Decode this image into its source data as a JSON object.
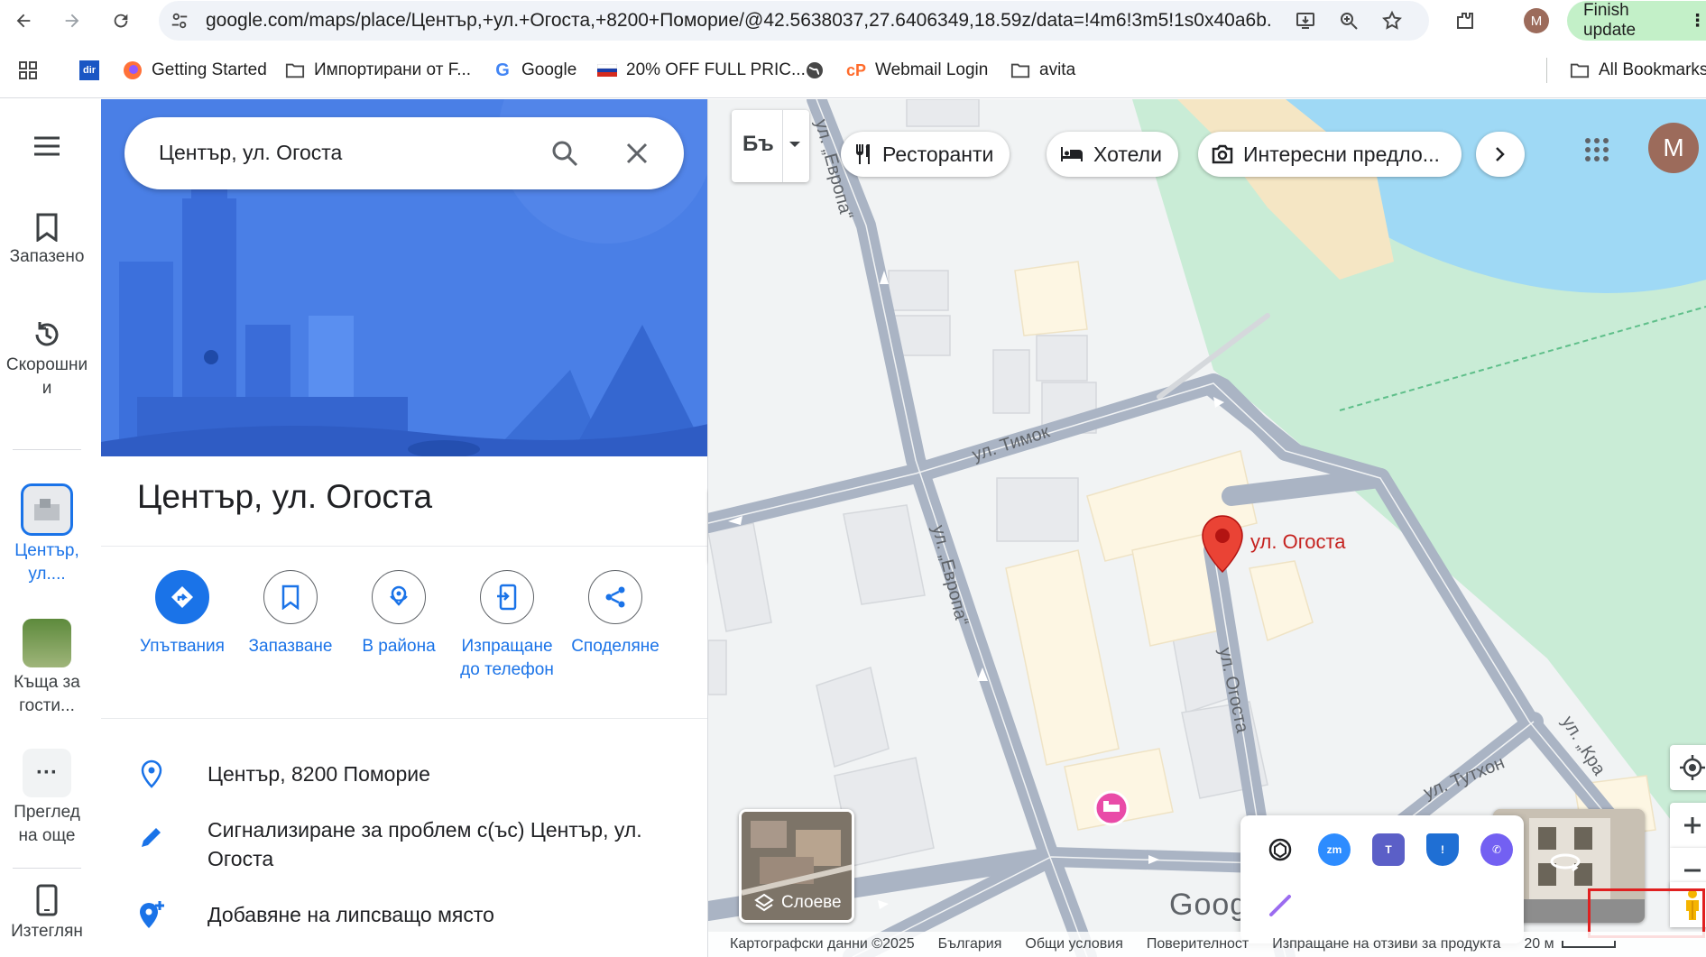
{
  "browser": {
    "url": "google.com/maps/place/Център,+ул.+Огоста,+8200+Поморие/@42.5638037,27.6406349,18.59z/data=!4m6!3m5!1s0x40a6b...",
    "profile_initial": "M",
    "finish_update_label": "Finish update",
    "bookmarks": [
      {
        "label": "",
        "icon": "apps-grid-icon"
      },
      {
        "label": "dir",
        "icon": "dir-badge-icon"
      },
      {
        "label": "Getting Started",
        "icon": "firefox-icon"
      },
      {
        "label": "Импортирани от F...",
        "icon": "folder-icon"
      },
      {
        "label": "Google",
        "icon": "google-g-icon"
      },
      {
        "label": "20% OFF FULL PRIC...",
        "icon": "flag-icon"
      },
      {
        "label": "",
        "icon": "globe-icon"
      },
      {
        "label": "Webmail Login",
        "icon": "cpanel-icon"
      },
      {
        "label": "avita",
        "icon": "folder-icon"
      },
      {
        "label": "All Bookmarks",
        "icon": "folder-icon"
      }
    ]
  },
  "rail": {
    "saved": "Запазено",
    "recents": "Скорошни",
    "recents_tail": "и",
    "current_place": "Център,",
    "current_place_tail": "ул....",
    "house": "Къща за",
    "house_tail": "гости...",
    "more": "Преглед",
    "more_tail": "на още",
    "mobile": "Изтеглян"
  },
  "panel": {
    "search_value": "Център, ул. Огоста",
    "place_title": "Център, ул. Огоста",
    "actions": [
      {
        "label": "Упътвания",
        "icon": "directions-icon"
      },
      {
        "label": "Запазване",
        "icon": "bookmark-icon"
      },
      {
        "label": "В района",
        "icon": "nearby-icon"
      },
      {
        "label": "Изпращане до телефон",
        "icon": "send-to-phone-icon"
      },
      {
        "label": "Споделяне",
        "icon": "share-icon"
      }
    ],
    "address": "Център, 8200 Поморие",
    "report": "Сигнализиране за проблем с(ъс) Център, ул. Огоста",
    "add_place": "Добавяне на липсващо място"
  },
  "map": {
    "chips": [
      "Ресторанти",
      "Хотели",
      "Интересни предло..."
    ],
    "layer_toggle_label": "Бъ",
    "streets": {
      "timok": "ул. Тимок",
      "evropa": "ул. „Европа“",
      "ogosta": "ул. Огоста",
      "tuthon": "ул. Тутхон",
      "kra": "ул. „Кра"
    },
    "pin_label": "ул. Огоста",
    "layers_label": "Слоеве",
    "google_logo": "Goog",
    "footer": {
      "map_data": "Картографски данни ©2025",
      "country": "България",
      "terms": "Общи условия",
      "privacy": "Поверителност",
      "feedback": "Изпращане на отзиви за продукта",
      "scale": "20 м"
    },
    "account_initial": "M"
  },
  "colors": {
    "accent": "#1a73e8",
    "pin": "#ea4335",
    "water": "#9fd9f5",
    "park": "#c9ecd6",
    "road": "#aab4c4",
    "highlight": "#e02020"
  }
}
